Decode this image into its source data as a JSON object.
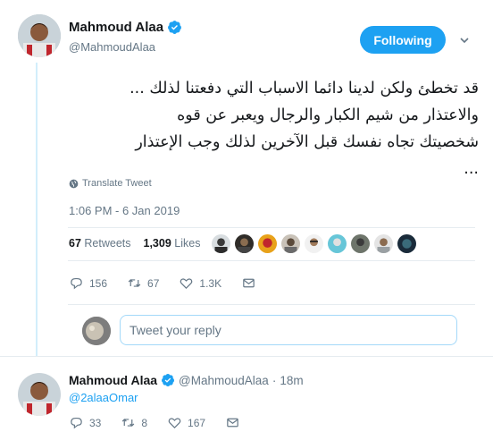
{
  "main_tweet": {
    "author_name": "Mahmoud Alaa",
    "author_handle": "@MahmoudAlaa",
    "follow_label": "Following",
    "text": "قد تخطئ ولكن لدينا دائما الاسباب التي دفعتنا لذلك ...\nوالاعتذار من شيم الكبار والرجال ويعبر عن قوه\nشخصيتك تجاه نفسك قبل الآخرين لذلك وجب الإعتذار\n...",
    "translate_label": "Translate Tweet",
    "timestamp": "1:06 PM - 6 Jan 2019",
    "retweets_count": "67",
    "retweets_label": "Retweets",
    "likes_count": "1,309",
    "likes_label": "Likes",
    "actions": {
      "replies": "156",
      "retweets": "67",
      "likes": "1.3K"
    }
  },
  "reply_box": {
    "placeholder": "Tweet your reply"
  },
  "second_tweet": {
    "author_name": "Mahmoud Alaa",
    "author_handle": "@MahmoudAlaa",
    "separator": "·",
    "time": "18m",
    "mention": "@2alaaOmar",
    "actions": {
      "replies": "33",
      "retweets": "8",
      "likes": "167"
    }
  },
  "colors": {
    "accent": "#1da1f2",
    "text_secondary": "#657786",
    "thread_line": "#d2eefb",
    "divider": "#e6ecf0"
  },
  "icons": [
    "verified-badge-icon",
    "chevron-down-icon",
    "globe-icon",
    "reply-icon",
    "retweet-icon",
    "like-icon",
    "message-icon"
  ]
}
